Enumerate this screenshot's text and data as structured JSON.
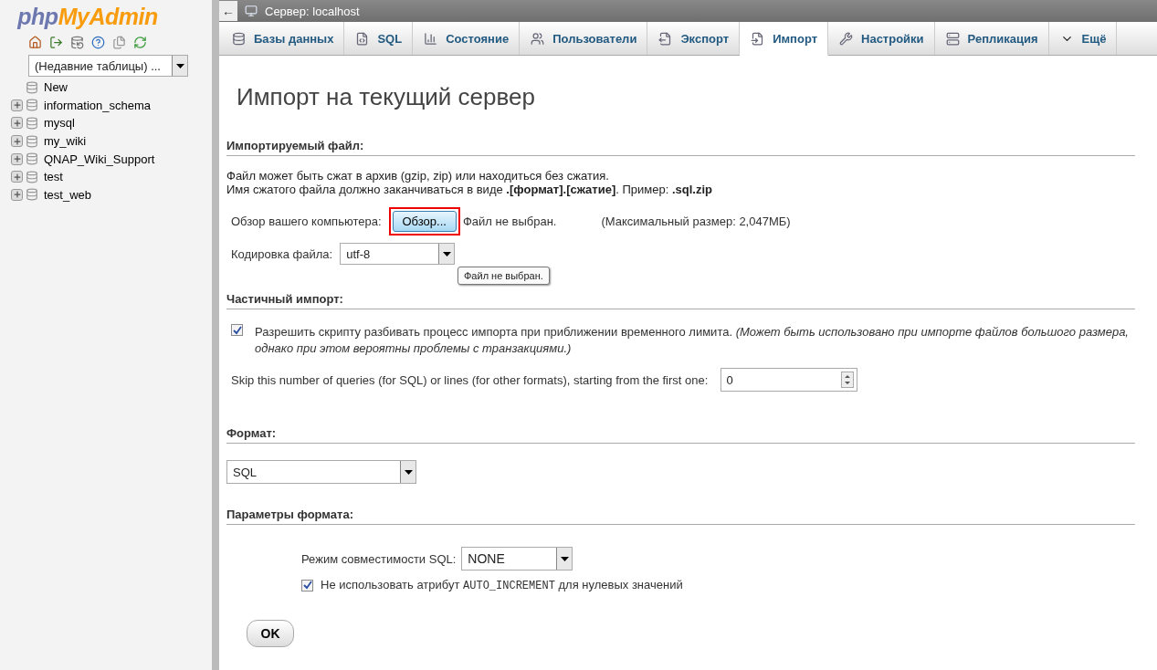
{
  "sidebar": {
    "logo": {
      "part1": "php",
      "part2": "MyAdmin"
    },
    "recent_select": {
      "value": "(Недавние таблицы) ..."
    },
    "tree": [
      {
        "kind": "new",
        "label": "New"
      },
      {
        "kind": "database",
        "label": "information_schema",
        "expanded": false
      },
      {
        "kind": "database",
        "label": "mysql",
        "expanded": false
      },
      {
        "kind": "database",
        "label": "my_wiki",
        "expanded": false
      },
      {
        "kind": "database",
        "label": "QNAP_Wiki_Support",
        "expanded": false
      },
      {
        "kind": "database",
        "label": "test",
        "expanded": false
      },
      {
        "kind": "database",
        "label": "test_web",
        "expanded": false
      }
    ]
  },
  "top_bar": {
    "back": "←",
    "title": "Сервер: localhost"
  },
  "tabs": [
    {
      "label": "Базы данных",
      "selected": false
    },
    {
      "label": "SQL",
      "selected": false
    },
    {
      "label": "Состояние",
      "selected": false
    },
    {
      "label": "Пользователи",
      "selected": false
    },
    {
      "label": "Экспорт",
      "selected": false
    },
    {
      "label": "Импорт",
      "selected": true
    },
    {
      "label": "Настройки",
      "selected": false
    },
    {
      "label": "Репликация",
      "selected": false
    },
    {
      "label": "Ещё",
      "selected": false
    }
  ],
  "page_title": "Импорт на текущий сервер",
  "file_section": {
    "legend": "Импортируемый файл:",
    "notes": [
      "Файл может быть сжат в архив (gzip, zip) или находиться без сжатия.",
      "Имя сжатого файла должно заканчиваться в виде **.[формат].[сжатие]**. Пример: **.sql.zip**"
    ],
    "browse_label": "Обзор вашего компьютера:",
    "browse_button": "Обзор...",
    "file_status": "Файл не выбран.",
    "max_size": "(Максимальный размер: 2,047МБ)",
    "charset_label": "Кодировка файла:",
    "charset_value": "utf-8",
    "tooltip": "Файл не выбран."
  },
  "partial_section": {
    "legend": "Частичный импорт:",
    "allow_interrupt": {
      "checked": true,
      "label": "Разрешить скрипту разбивать процесс импорта при приближении временного лимита. *(Может быть использовано при импорте файлов большого размера, однако при этом вероятны проблемы с транзакциями.)*"
    },
    "skip_label": "Skip this number of queries (for SQL) or lines (for other formats), starting from the first one:",
    "skip_value": "0"
  },
  "format_section": {
    "legend": "Формат:",
    "value": "SQL"
  },
  "options_section": {
    "legend": "Параметры формата:",
    "compat_label": "Режим совместимости SQL:",
    "compat_value": "NONE",
    "no_auto_value": {
      "checked": true,
      "before": "Не использовать атрибут",
      "code": "AUTO_INCREMENT",
      "after": "для нулевых значений"
    }
  },
  "ok_button": "OK"
}
